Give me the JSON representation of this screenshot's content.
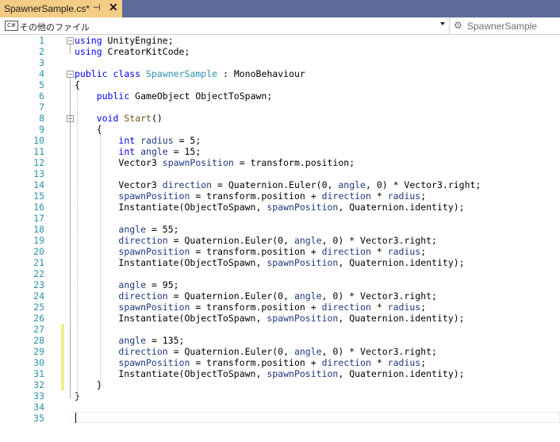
{
  "tab": {
    "title": "SpawnerSample.cs*",
    "pin_icon": "⊣",
    "close_icon": "✕"
  },
  "navbar": {
    "project_label": "その他のファイル",
    "cs_badge": "C#",
    "class_label": "SpawnerSample",
    "class_icon": "⚙"
  },
  "editor": {
    "line_numbers": [
      "1",
      "2",
      "3",
      "4",
      "5",
      "6",
      "7",
      "8",
      "9",
      "10",
      "11",
      "12",
      "13",
      "14",
      "15",
      "16",
      "17",
      "18",
      "19",
      "20",
      "21",
      "22",
      "23",
      "24",
      "25",
      "26",
      "27",
      "28",
      "29",
      "30",
      "31",
      "32",
      "33",
      "34",
      "35"
    ],
    "lines": [
      "using UnityEngine;",
      "using CreatorKitCode;",
      "",
      "public class SpawnerSample : MonoBehaviour",
      "{",
      "    public GameObject ObjectToSpawn;",
      "",
      "    void Start()",
      "    {",
      "        int radius = 5;",
      "        int angle = 15;",
      "        Vector3 spawnPosition = transform.position;",
      "",
      "        Vector3 direction = Quaternion.Euler(0, angle, 0) * Vector3.right;",
      "        spawnPosition = transform.position + direction * radius;",
      "        Instantiate(ObjectToSpawn, spawnPosition, Quaternion.identity);",
      "",
      "        angle = 55;",
      "        direction = Quaternion.Euler(0, angle, 0) * Vector3.right;",
      "        spawnPosition = transform.position + direction * radius;",
      "        Instantiate(ObjectToSpawn, spawnPosition, Quaternion.identity);",
      "",
      "        angle = 95;",
      "        direction = Quaternion.Euler(0, angle, 0) * Vector3.right;",
      "        spawnPosition = transform.position + direction * radius;",
      "        Instantiate(ObjectToSpawn, spawnPosition, Quaternion.identity);",
      "",
      "        angle = 135;",
      "        direction = Quaternion.Euler(0, angle, 0) * Vector3.right;",
      "        spawnPosition = transform.position + direction * radius;",
      "        Instantiate(ObjectToSpawn, spawnPosition, Quaternion.identity);",
      "    }",
      "}",
      "",
      ""
    ]
  },
  "colors": {
    "tab_bar": "#5d6b99",
    "active_tab": "#f5cc84",
    "line_number": "#2b91af",
    "keyword": "#0000ff",
    "type": "#2b91af",
    "variable": "#1f377f",
    "method": "#74531f",
    "change_marker": "#eff08d"
  }
}
